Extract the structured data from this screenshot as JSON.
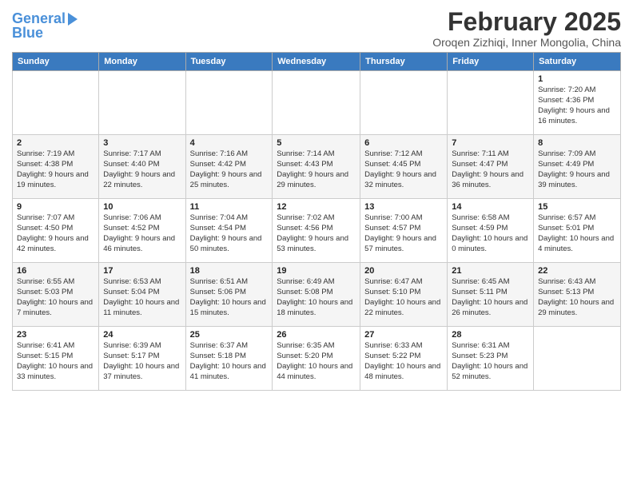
{
  "header": {
    "logo_line1": "General",
    "logo_line2": "Blue",
    "title": "February 2025",
    "subtitle": "Oroqen Zizhiqi, Inner Mongolia, China"
  },
  "calendar": {
    "days_of_week": [
      "Sunday",
      "Monday",
      "Tuesday",
      "Wednesday",
      "Thursday",
      "Friday",
      "Saturday"
    ],
    "weeks": [
      [
        {
          "day": "",
          "info": ""
        },
        {
          "day": "",
          "info": ""
        },
        {
          "day": "",
          "info": ""
        },
        {
          "day": "",
          "info": ""
        },
        {
          "day": "",
          "info": ""
        },
        {
          "day": "",
          "info": ""
        },
        {
          "day": "1",
          "info": "Sunrise: 7:20 AM\nSunset: 4:36 PM\nDaylight: 9 hours and 16 minutes."
        }
      ],
      [
        {
          "day": "2",
          "info": "Sunrise: 7:19 AM\nSunset: 4:38 PM\nDaylight: 9 hours and 19 minutes."
        },
        {
          "day": "3",
          "info": "Sunrise: 7:17 AM\nSunset: 4:40 PM\nDaylight: 9 hours and 22 minutes."
        },
        {
          "day": "4",
          "info": "Sunrise: 7:16 AM\nSunset: 4:42 PM\nDaylight: 9 hours and 25 minutes."
        },
        {
          "day": "5",
          "info": "Sunrise: 7:14 AM\nSunset: 4:43 PM\nDaylight: 9 hours and 29 minutes."
        },
        {
          "day": "6",
          "info": "Sunrise: 7:12 AM\nSunset: 4:45 PM\nDaylight: 9 hours and 32 minutes."
        },
        {
          "day": "7",
          "info": "Sunrise: 7:11 AM\nSunset: 4:47 PM\nDaylight: 9 hours and 36 minutes."
        },
        {
          "day": "8",
          "info": "Sunrise: 7:09 AM\nSunset: 4:49 PM\nDaylight: 9 hours and 39 minutes."
        }
      ],
      [
        {
          "day": "9",
          "info": "Sunrise: 7:07 AM\nSunset: 4:50 PM\nDaylight: 9 hours and 42 minutes."
        },
        {
          "day": "10",
          "info": "Sunrise: 7:06 AM\nSunset: 4:52 PM\nDaylight: 9 hours and 46 minutes."
        },
        {
          "day": "11",
          "info": "Sunrise: 7:04 AM\nSunset: 4:54 PM\nDaylight: 9 hours and 50 minutes."
        },
        {
          "day": "12",
          "info": "Sunrise: 7:02 AM\nSunset: 4:56 PM\nDaylight: 9 hours and 53 minutes."
        },
        {
          "day": "13",
          "info": "Sunrise: 7:00 AM\nSunset: 4:57 PM\nDaylight: 9 hours and 57 minutes."
        },
        {
          "day": "14",
          "info": "Sunrise: 6:58 AM\nSunset: 4:59 PM\nDaylight: 10 hours and 0 minutes."
        },
        {
          "day": "15",
          "info": "Sunrise: 6:57 AM\nSunset: 5:01 PM\nDaylight: 10 hours and 4 minutes."
        }
      ],
      [
        {
          "day": "16",
          "info": "Sunrise: 6:55 AM\nSunset: 5:03 PM\nDaylight: 10 hours and 7 minutes."
        },
        {
          "day": "17",
          "info": "Sunrise: 6:53 AM\nSunset: 5:04 PM\nDaylight: 10 hours and 11 minutes."
        },
        {
          "day": "18",
          "info": "Sunrise: 6:51 AM\nSunset: 5:06 PM\nDaylight: 10 hours and 15 minutes."
        },
        {
          "day": "19",
          "info": "Sunrise: 6:49 AM\nSunset: 5:08 PM\nDaylight: 10 hours and 18 minutes."
        },
        {
          "day": "20",
          "info": "Sunrise: 6:47 AM\nSunset: 5:10 PM\nDaylight: 10 hours and 22 minutes."
        },
        {
          "day": "21",
          "info": "Sunrise: 6:45 AM\nSunset: 5:11 PM\nDaylight: 10 hours and 26 minutes."
        },
        {
          "day": "22",
          "info": "Sunrise: 6:43 AM\nSunset: 5:13 PM\nDaylight: 10 hours and 29 minutes."
        }
      ],
      [
        {
          "day": "23",
          "info": "Sunrise: 6:41 AM\nSunset: 5:15 PM\nDaylight: 10 hours and 33 minutes."
        },
        {
          "day": "24",
          "info": "Sunrise: 6:39 AM\nSunset: 5:17 PM\nDaylight: 10 hours and 37 minutes."
        },
        {
          "day": "25",
          "info": "Sunrise: 6:37 AM\nSunset: 5:18 PM\nDaylight: 10 hours and 41 minutes."
        },
        {
          "day": "26",
          "info": "Sunrise: 6:35 AM\nSunset: 5:20 PM\nDaylight: 10 hours and 44 minutes."
        },
        {
          "day": "27",
          "info": "Sunrise: 6:33 AM\nSunset: 5:22 PM\nDaylight: 10 hours and 48 minutes."
        },
        {
          "day": "28",
          "info": "Sunrise: 6:31 AM\nSunset: 5:23 PM\nDaylight: 10 hours and 52 minutes."
        },
        {
          "day": "",
          "info": ""
        }
      ]
    ]
  }
}
